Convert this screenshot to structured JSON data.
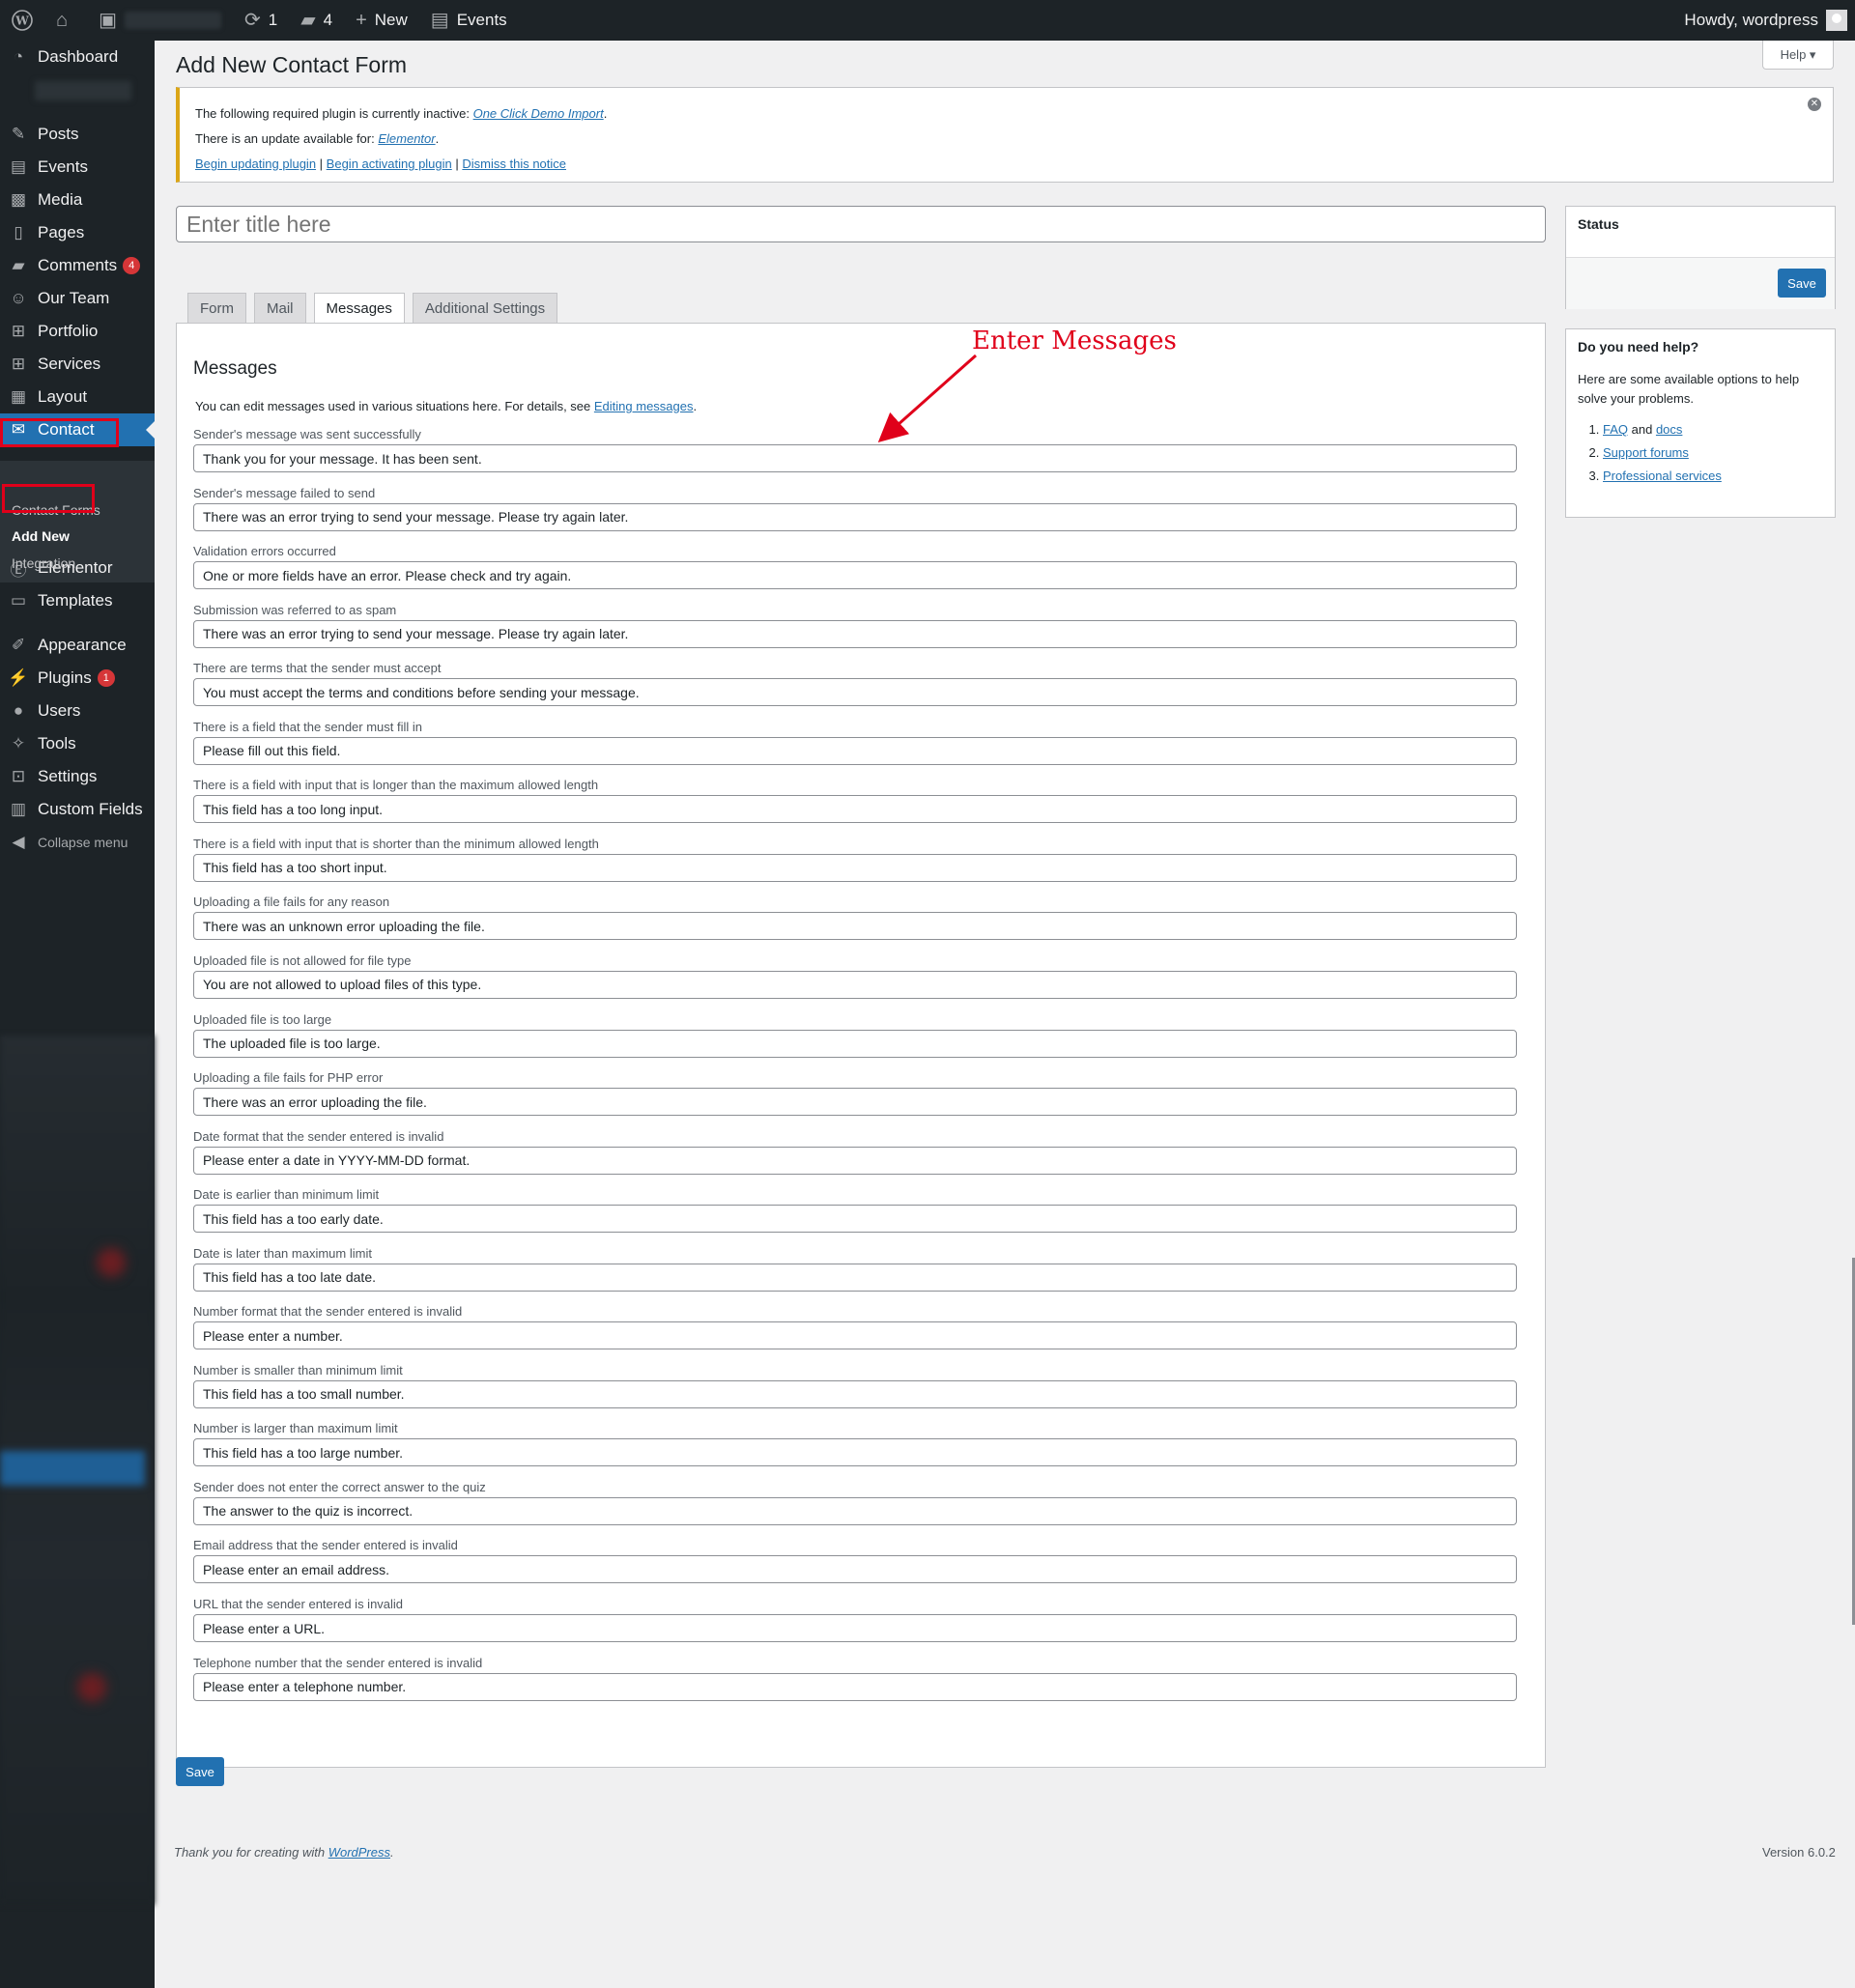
{
  "adminbar": {
    "updates_count": "1",
    "comments_count": "4",
    "new_label": "New",
    "events_label": "Events",
    "howdy": "Howdy, wordpress"
  },
  "sidebar": {
    "items": [
      {
        "label": "Dashboard",
        "icon": "dashboard-icon"
      },
      {
        "label": "Posts",
        "icon": "pin-icon"
      },
      {
        "label": "Events",
        "icon": "calendar-icon"
      },
      {
        "label": "Media",
        "icon": "media-icon"
      },
      {
        "label": "Pages",
        "icon": "pages-icon"
      },
      {
        "label": "Comments",
        "icon": "comment-icon",
        "badge": "4"
      },
      {
        "label": "Our Team",
        "icon": "team-icon"
      },
      {
        "label": "Portfolio",
        "icon": "grid-icon"
      },
      {
        "label": "Services",
        "icon": "grid-icon"
      },
      {
        "label": "Layout",
        "icon": "layout-icon"
      },
      {
        "label": "Contact",
        "icon": "mail-icon"
      },
      {
        "label": "Elementor",
        "icon": "elementor-icon"
      },
      {
        "label": "Templates",
        "icon": "folder-icon"
      },
      {
        "label": "Appearance",
        "icon": "brush-icon"
      },
      {
        "label": "Plugins",
        "icon": "plugin-icon",
        "badge": "1"
      },
      {
        "label": "Users",
        "icon": "user-icon"
      },
      {
        "label": "Tools",
        "icon": "wrench-icon"
      },
      {
        "label": "Settings",
        "icon": "settings-icon"
      },
      {
        "label": "Custom Fields",
        "icon": "table-icon"
      },
      {
        "label": "Collapse menu",
        "icon": "collapse-icon"
      }
    ],
    "submenu": [
      "Contact Forms",
      "Add New",
      "Integration"
    ]
  },
  "page": {
    "title": "Add New Contact Form",
    "help_label": "Help ▾",
    "title_placeholder": "Enter title here"
  },
  "notice": {
    "line1_prefix": "The following required plugin is currently inactive: ",
    "line1_link": "One Click Demo Import",
    "line2_prefix": "There is an update available for: ",
    "line2_link": "Elementor",
    "begin_updating": "Begin updating plugin",
    "begin_activating": "Begin activating plugin",
    "dismiss": "Dismiss this notice"
  },
  "tabs": [
    "Form",
    "Mail",
    "Messages",
    "Additional Settings"
  ],
  "messages": {
    "heading": "Messages",
    "intro_prefix": "You can edit messages used in various situations here. For details, see ",
    "intro_link": "Editing messages",
    "fields": [
      {
        "label": "Sender's message was sent successfully",
        "value": "Thank you for your message. It has been sent."
      },
      {
        "label": "Sender's message failed to send",
        "value": "There was an error trying to send your message. Please try again later."
      },
      {
        "label": "Validation errors occurred",
        "value": "One or more fields have an error. Please check and try again."
      },
      {
        "label": "Submission was referred to as spam",
        "value": "There was an error trying to send your message. Please try again later."
      },
      {
        "label": "There are terms that the sender must accept",
        "value": "You must accept the terms and conditions before sending your message."
      },
      {
        "label": "There is a field that the sender must fill in",
        "value": "Please fill out this field."
      },
      {
        "label": "There is a field with input that is longer than the maximum allowed length",
        "value": "This field has a too long input."
      },
      {
        "label": "There is a field with input that is shorter than the minimum allowed length",
        "value": "This field has a too short input."
      },
      {
        "label": "Uploading a file fails for any reason",
        "value": "There was an unknown error uploading the file."
      },
      {
        "label": "Uploaded file is not allowed for file type",
        "value": "You are not allowed to upload files of this type."
      },
      {
        "label": "Uploaded file is too large",
        "value": "The uploaded file is too large."
      },
      {
        "label": "Uploading a file fails for PHP error",
        "value": "There was an error uploading the file."
      },
      {
        "label": "Date format that the sender entered is invalid",
        "value": "Please enter a date in YYYY-MM-DD format."
      },
      {
        "label": "Date is earlier than minimum limit",
        "value": "This field has a too early date."
      },
      {
        "label": "Date is later than maximum limit",
        "value": "This field has a too late date."
      },
      {
        "label": "Number format that the sender entered is invalid",
        "value": "Please enter a number."
      },
      {
        "label": "Number is smaller than minimum limit",
        "value": "This field has a too small number."
      },
      {
        "label": "Number is larger than maximum limit",
        "value": "This field has a too large number."
      },
      {
        "label": "Sender does not enter the correct answer to the quiz",
        "value": "The answer to the quiz is incorrect."
      },
      {
        "label": "Email address that the sender entered is invalid",
        "value": "Please enter an email address."
      },
      {
        "label": "URL that the sender entered is invalid",
        "value": "Please enter a URL."
      },
      {
        "label": "Telephone number that the sender entered is invalid",
        "value": "Please enter a telephone number."
      }
    ]
  },
  "annotation": "Enter Messages",
  "status_box": {
    "title": "Status",
    "save_label": "Save"
  },
  "help_box": {
    "title": "Do you need help?",
    "text": "Here are some available options to help solve your problems.",
    "links": [
      {
        "parts": [
          "FAQ",
          " and ",
          "docs"
        ]
      },
      {
        "parts": [
          "Support forums"
        ]
      },
      {
        "parts": [
          "Professional services"
        ]
      }
    ]
  },
  "bottom_save_label": "Save",
  "footer": {
    "thanks_prefix": "Thank you for creating with ",
    "thanks_link": "WordPress",
    "thanks_suffix": ".",
    "version": "Version 6.0.2"
  },
  "colors": {
    "accent": "#2271b1",
    "sidebar_bg": "#1d2327",
    "notice_warning": "#dba617",
    "annotation_red": "#e0001a"
  }
}
